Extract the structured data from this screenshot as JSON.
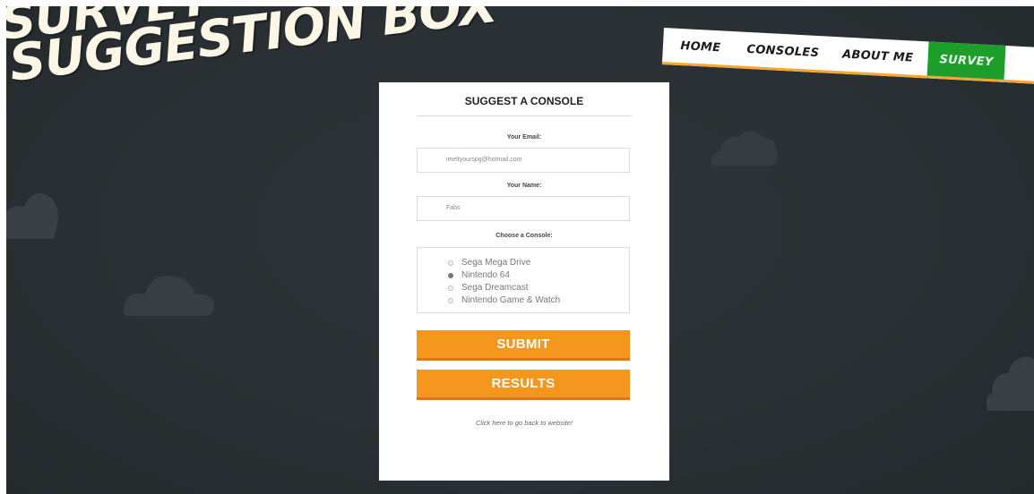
{
  "header": {
    "logo_line1": "SURVEY",
    "logo_line2": "SUGGESTION BOX"
  },
  "nav": {
    "items": [
      {
        "label": "HOME"
      },
      {
        "label": "CONSOLES"
      },
      {
        "label": "ABOUT ME"
      },
      {
        "label": "SURVEY"
      }
    ],
    "active": "SURVEY"
  },
  "form": {
    "title": "SUGGEST A CONSOLE",
    "email_label": "Your Email:",
    "email_value": "imeltyourspg@hotmail.com",
    "name_label": "Your Name:",
    "name_value": "Fabs",
    "console_label": "Choose a Console:",
    "options": [
      {
        "label": "Sega Mega Drive",
        "checked": false
      },
      {
        "label": "Nintendo 64",
        "checked": true
      },
      {
        "label": "Sega Dreamcast",
        "checked": false
      },
      {
        "label": "Nintendo Game & Watch",
        "checked": false
      }
    ],
    "submit_label": "SUBMIT",
    "results_label": "RESULTS",
    "back_link": "Click here to go back to website!"
  },
  "colors": {
    "background": "#2a3033",
    "accent": "#f5961f",
    "nav_active": "#1d9e2b",
    "logo_text": "#fbf6e6"
  }
}
